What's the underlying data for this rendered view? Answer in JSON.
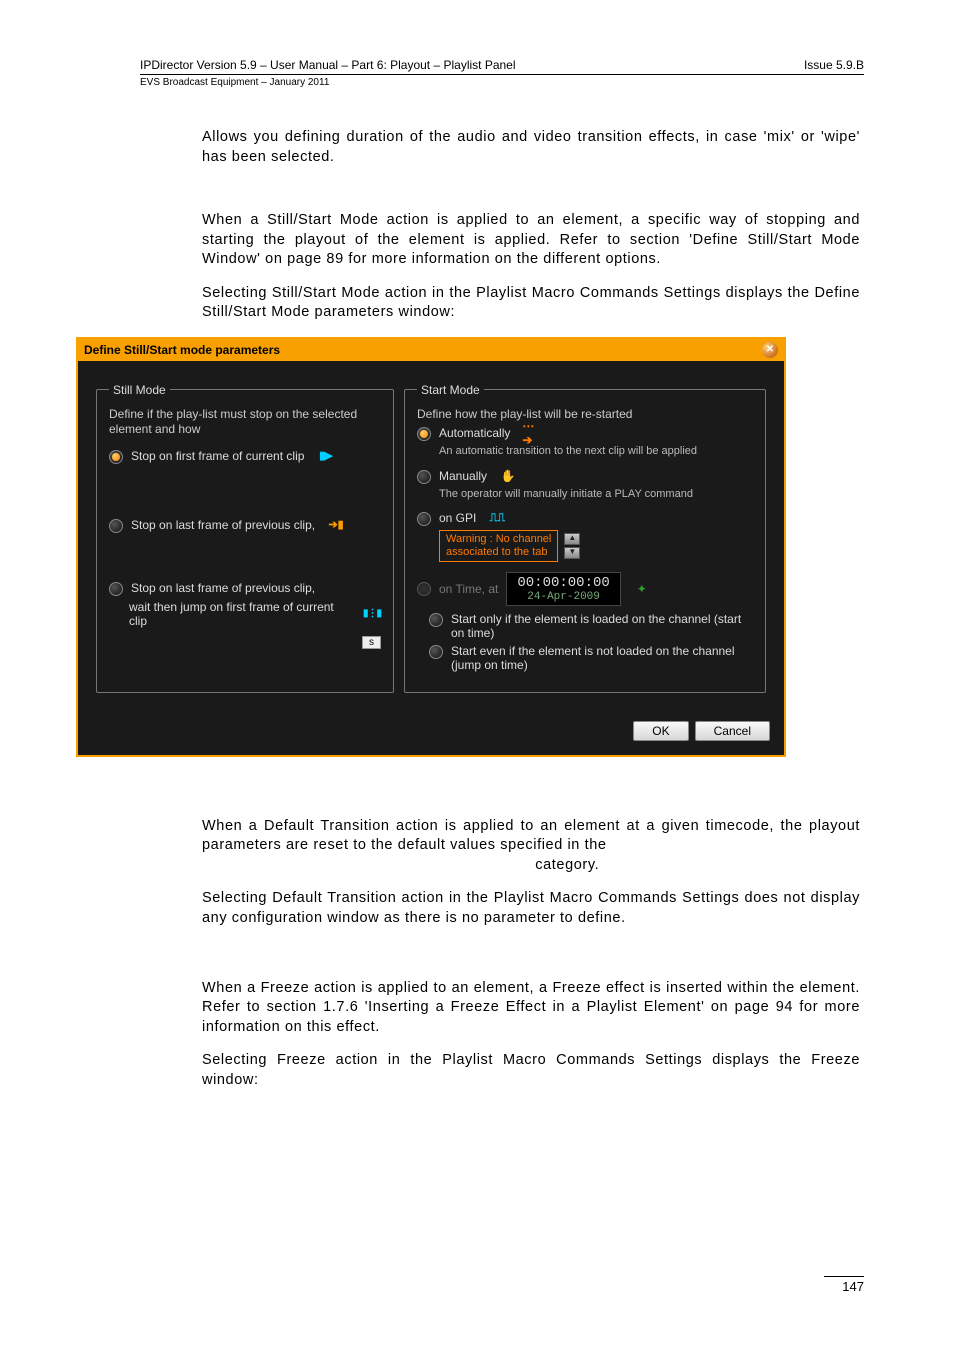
{
  "header": {
    "left": "IPDirector Version 5.9 – User Manual – Part 6: Playout – Playlist Panel",
    "right": "Issue 5.9.B",
    "sub": "EVS Broadcast Equipment – January 2011"
  },
  "paras": {
    "p1": "Allows you defining duration of the audio and video transition effects, in case 'mix' or 'wipe' has been selected.",
    "p2": "When a Still/Start Mode action is applied to an element, a specific way of stopping and starting the playout of the element is applied. Refer to section 'Define Still/Start Mode Window' on page 89 for more information on the different options.",
    "p3": "Selecting Still/Start Mode action in the Playlist Macro Commands Settings displays the Define Still/Start Mode parameters window:",
    "p4a": "When a Default Transition action is applied to an element at a given timecode, the playout parameters are reset to the default values specified in the",
    "p4b": "                                                                        category.",
    "p5": "Selecting Default Transition action in the Playlist Macro Commands Settings does not display any configuration window as there is no parameter to define.",
    "p6": "When a Freeze action is applied to an element, a Freeze effect is inserted within the element. Refer to section 1.7.6 'Inserting a Freeze Effect in a Playlist Element' on page 94 for more information on this effect.",
    "p7": "Selecting Freeze action in the Playlist Macro Commands Settings displays the Freeze window:"
  },
  "dialog": {
    "title": "Define Still/Start mode parameters",
    "still": {
      "legend": "Still Mode",
      "desc": "Define if the play-list must stop on  the selected element and how",
      "opt1": "Stop on first frame of current clip",
      "opt2": "Stop on last frame of previous clip,",
      "opt3a": "Stop on last frame of previous clip,",
      "opt3b": "wait then jump on first frame of current clip",
      "sbtn": "s"
    },
    "start": {
      "legend": "Start Mode",
      "desc": "Define how the play-list will be re-started",
      "auto": "Automatically",
      "auto_sub": "An automatic transition to the next clip will be applied",
      "man": "Manually",
      "man_sub": "The operator will manually initiate a PLAY command",
      "gpi": "on GPI",
      "warn1": "Warning : No channel",
      "warn2": "associated to the tab",
      "ontime": "on Time, at",
      "tc": "00:00:00:00",
      "date": "24-Apr-2009",
      "startonly": "Start only if the element is loaded on the channel (start on time)",
      "starteven": "Start even if the element is not loaded on the channel (jump on time)"
    },
    "ok": "OK",
    "cancel": "Cancel"
  },
  "page_number": "147",
  "chart_data": null
}
